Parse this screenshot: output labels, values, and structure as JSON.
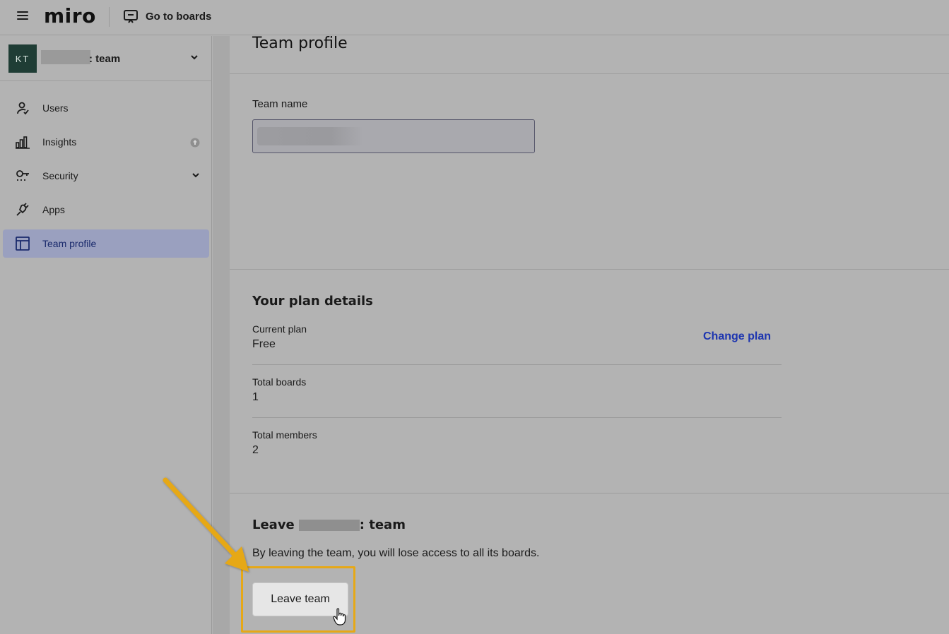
{
  "topbar": {
    "logo": "miro",
    "goto_boards_label": "Go to boards"
  },
  "sidebar": {
    "team": {
      "avatar_initials": "KT",
      "name_suffix": ": team"
    },
    "items": [
      {
        "label": "Users",
        "icon": "user-icon"
      },
      {
        "label": "Insights",
        "icon": "bar-chart-icon",
        "badge_icon": "upgrade-icon"
      },
      {
        "label": "Security",
        "icon": "key-icon",
        "expandable": true
      },
      {
        "label": "Apps",
        "icon": "plug-icon"
      },
      {
        "label": "Team profile",
        "icon": "layout-icon",
        "active": true
      }
    ]
  },
  "main": {
    "page_title": "Team profile",
    "team_name": {
      "label": "Team name"
    },
    "plan": {
      "title": "Your plan details",
      "current_plan_label": "Current plan",
      "current_plan_value": "Free",
      "change_plan_label": "Change plan",
      "total_boards_label": "Total boards",
      "total_boards_value": "1",
      "total_members_label": "Total members",
      "total_members_value": "2"
    },
    "leave": {
      "title_prefix": "Leave",
      "title_suffix": ": team",
      "description": "By leaving the team, you will lose access to all its boards.",
      "button_label": "Leave team"
    }
  },
  "annotation": {
    "arrow_color": "#e6a817",
    "highlight_color": "#e6a817"
  }
}
